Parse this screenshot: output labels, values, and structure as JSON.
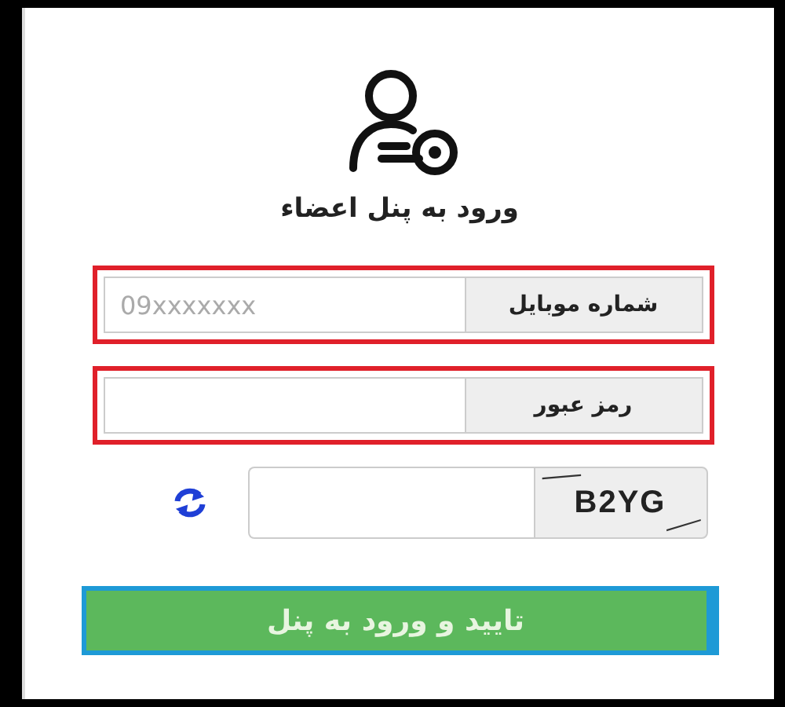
{
  "title": "ورود به پنل اعضاء",
  "fields": [
    {
      "label": "شماره موبایل",
      "placeholder": "09xxxxxxx",
      "highlighted": true
    },
    {
      "label": "رمز عبور",
      "highlighted": true
    }
  ],
  "captcha": {
    "code": "B2YG"
  },
  "submit": {
    "label": "تایید و ورود به پنل",
    "focused": true
  }
}
